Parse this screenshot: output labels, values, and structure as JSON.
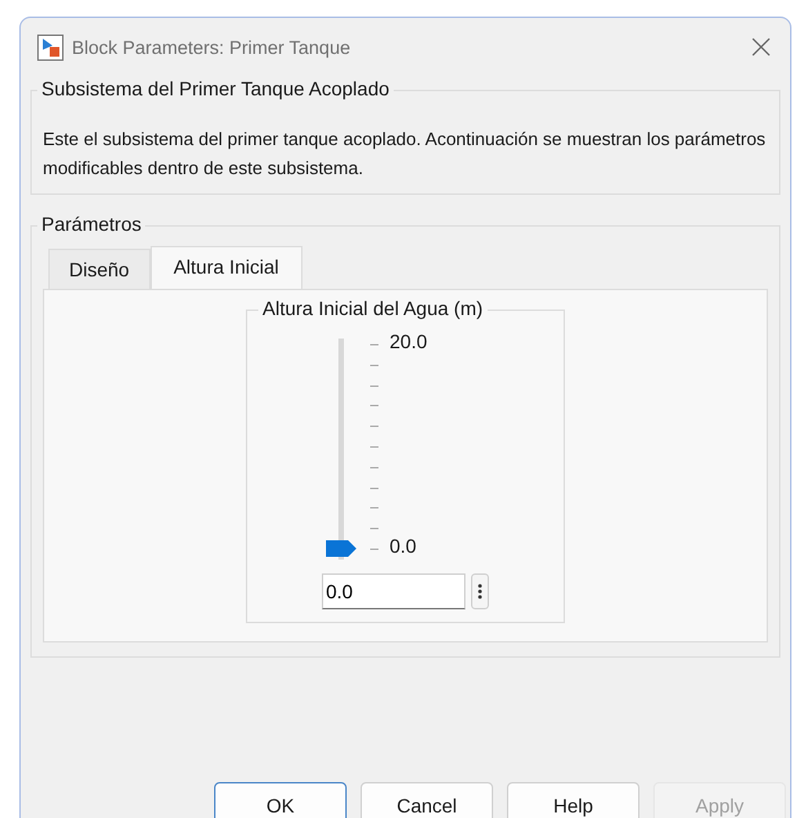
{
  "window": {
    "title": "Block Parameters: Primer Tanque"
  },
  "subsystem": {
    "title": "Subsistema del Primer Tanque Acoplado",
    "description": "Este el subsistema del primer tanque acoplado. Acontinuación se muestran los parámetros modificables dentro de este subsistema."
  },
  "parameters": {
    "title": "Parámetros",
    "tabs": [
      {
        "label": "Diseño",
        "selected": false
      },
      {
        "label": "Altura Inicial",
        "selected": true
      }
    ],
    "slider_group": {
      "title": "Altura Inicial del Agua (m)",
      "max_label": "20.0",
      "min_label": "0.0",
      "level": 0,
      "value": "0.0"
    }
  },
  "buttons": [
    {
      "label": "OK",
      "default": true,
      "disabled": false
    },
    {
      "label": "Cancel",
      "default": false,
      "disabled": false
    },
    {
      "label": "Help",
      "default": false,
      "disabled": false
    },
    {
      "label": "Apply",
      "default": false,
      "disabled": true
    }
  ]
}
